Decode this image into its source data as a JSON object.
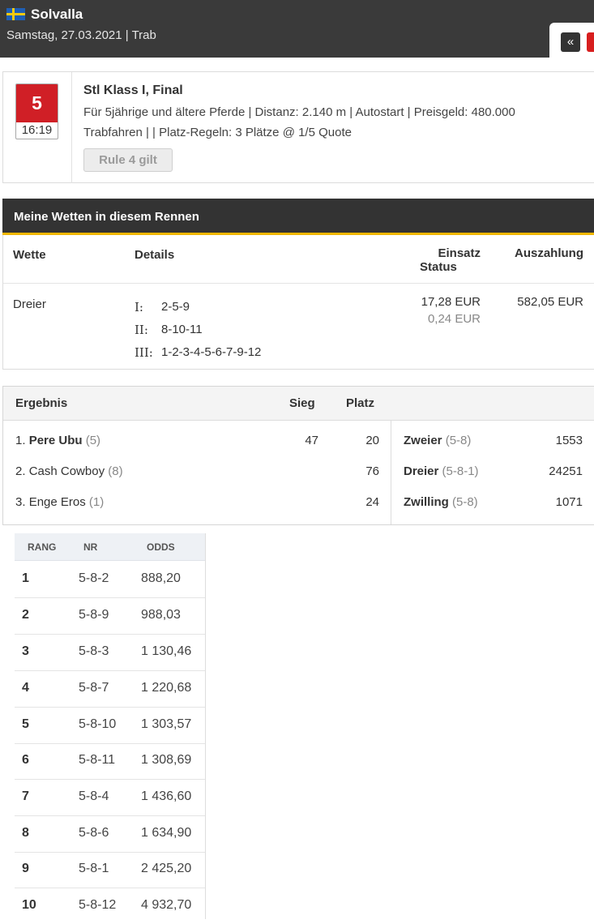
{
  "header": {
    "track": "Solvalla",
    "date_line": "Samstag, 27.03.2021  |  Trab",
    "nav_label": "«",
    "flag_colors": {
      "blue": "#1f5fb4",
      "yellow": "#f6c90e"
    }
  },
  "race": {
    "number": "5",
    "time": "16:19",
    "title": "Stl Klass I, Final",
    "line1": "Für 5jährige und ältere Pferde  |  Distanz: 2.140 m  |  Autostart  |  Preisgeld: 480.000",
    "line2": "Trabfahren  |    |  Platz-Regeln: 3 Plätze @ 1/5 Quote",
    "rule_button": "Rule 4 gilt",
    "badge_color": "#d01f26"
  },
  "bets": {
    "title": "Meine Wetten in diesem Rennen",
    "accent": "#f2b705",
    "headers": {
      "wette": "Wette",
      "details": "Details",
      "einsatz": "Einsatz",
      "status": "Status",
      "auszahlung": "Auszahlung"
    },
    "rows": [
      {
        "wette": "Dreier",
        "legs": [
          {
            "label": "I:",
            "value": "2-5-9"
          },
          {
            "label": "II:",
            "value": "8-10-11"
          },
          {
            "label": "III:",
            "value": "1-2-3-4-5-6-7-9-12"
          }
        ],
        "einsatz": "17,28 EUR",
        "status": "0,24 EUR",
        "auszahlung": "582,05 EUR"
      }
    ]
  },
  "results": {
    "headers": {
      "ergebnis": "Ergebnis",
      "sieg": "Sieg",
      "platz": "Platz"
    },
    "rows": [
      {
        "pos": "1.",
        "name": "Pere Ubu",
        "nr": "(5)",
        "sieg": "47",
        "platz": "20",
        "bold": true
      },
      {
        "pos": "2.",
        "name": "Cash Cowboy",
        "nr": "(8)",
        "sieg": "",
        "platz": "76",
        "bold": false
      },
      {
        "pos": "3.",
        "name": "Enge Eros",
        "nr": "(1)",
        "sieg": "",
        "platz": "24",
        "bold": false
      }
    ],
    "exotics": [
      {
        "name": "Zweier",
        "combo": "(5-8)",
        "value": "1553"
      },
      {
        "name": "Dreier",
        "combo": "(5-8-1)",
        "value": "24251"
      },
      {
        "name": "Zwilling",
        "combo": "(5-8)",
        "value": "1071"
      }
    ]
  },
  "odds_table": {
    "headers": {
      "rang": "RANG",
      "nr": "NR",
      "odds": "ODDS"
    },
    "rows": [
      {
        "rang": "1",
        "nr": "5-8-2",
        "odds": "888,20"
      },
      {
        "rang": "2",
        "nr": "5-8-9",
        "odds": "988,03"
      },
      {
        "rang": "3",
        "nr": "5-8-3",
        "odds": "1 130,46"
      },
      {
        "rang": "4",
        "nr": "5-8-7",
        "odds": "1 220,68"
      },
      {
        "rang": "5",
        "nr": "5-8-10",
        "odds": "1 303,57"
      },
      {
        "rang": "6",
        "nr": "5-8-11",
        "odds": "1 308,69"
      },
      {
        "rang": "7",
        "nr": "5-8-4",
        "odds": "1 436,60"
      },
      {
        "rang": "8",
        "nr": "5-8-6",
        "odds": "1 634,90"
      },
      {
        "rang": "9",
        "nr": "5-8-1",
        "odds": "2 425,20"
      },
      {
        "rang": "10",
        "nr": "5-8-12",
        "odds": "4 932,70"
      }
    ]
  }
}
